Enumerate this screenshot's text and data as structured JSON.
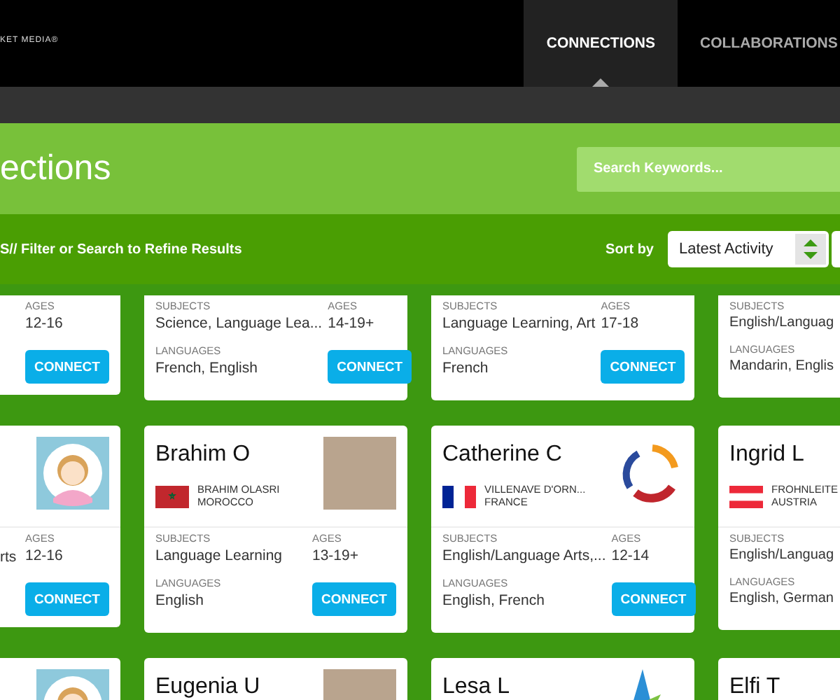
{
  "header": {
    "logo_text": "KET MEDIA®",
    "nav": [
      {
        "label": "CONNECTIONS",
        "selected": true
      },
      {
        "label": "COLLABORATIONS",
        "selected": false
      }
    ]
  },
  "title_band": {
    "title": "ections",
    "search": {
      "placeholder": "Search Keywords..."
    }
  },
  "filter_bar": {
    "hint": "S// Filter or Search to Refine Results",
    "sort_label": "Sort by",
    "sort_value": "Latest Activity"
  },
  "cards": [
    {
      "kind": "left",
      "ages": {
        "label": "AGES",
        "value": "12-16"
      },
      "connect": "CONNECT"
    },
    {
      "kind": "full",
      "subjects": {
        "label": "SUBJECTS",
        "value": "Science, Language Lea..."
      },
      "ages": {
        "label": "AGES",
        "value": "14-19+"
      },
      "languages": {
        "label": "LANGUAGES",
        "value": "French, English"
      },
      "connect": "CONNECT"
    },
    {
      "kind": "full",
      "subjects": {
        "label": "SUBJECTS",
        "value": "Language Learning, Art"
      },
      "ages": {
        "label": "AGES",
        "value": "17-18"
      },
      "languages": {
        "label": "LANGUAGES",
        "value": "French"
      },
      "connect": "CONNECT"
    },
    {
      "kind": "right",
      "subjects": {
        "label": "SUBJECTS",
        "value": "English/Languag"
      },
      "languages": {
        "label": "LANGUAGES",
        "value": "Mandarin, Englis"
      }
    },
    {
      "kind": "left",
      "avatar": {
        "kind": "cartoon"
      },
      "subjects": {
        "value": "rts"
      },
      "ages": {
        "label": "AGES",
        "value": "12-16"
      },
      "connect": "CONNECT"
    },
    {
      "kind": "full",
      "name": "Brahim O",
      "flag": {
        "kind": "morocco"
      },
      "place": "BRAHIM OLASRI",
      "country": "MOROCCO",
      "avatar": {
        "kind": "photo"
      },
      "subjects": {
        "label": "SUBJECTS",
        "value": "Language Learning"
      },
      "ages": {
        "label": "AGES",
        "value": "13-19+"
      },
      "languages": {
        "label": "LANGUAGES",
        "value": "English"
      },
      "connect": "CONNECT"
    },
    {
      "kind": "full",
      "name": "Catherine C",
      "flag": {
        "kind": "france"
      },
      "place": "VILLENAVE D'ORN...",
      "country": "FRANCE",
      "avatar": {
        "kind": "swirl"
      },
      "subjects": {
        "label": "SUBJECTS",
        "value": "English/Language Arts,..."
      },
      "ages": {
        "label": "AGES",
        "value": "12-14"
      },
      "languages": {
        "label": "LANGUAGES",
        "value": "English, French"
      },
      "connect": "CONNECT"
    },
    {
      "kind": "right",
      "name": "Ingrid L",
      "flag": {
        "kind": "austria"
      },
      "place": "FROHNLEITE",
      "country": "AUSTRIA",
      "subjects": {
        "label": "SUBJECTS",
        "value": "English/Languag"
      },
      "languages": {
        "label": "LANGUAGES",
        "value": "English, German"
      }
    },
    {
      "kind": "left",
      "avatar": {
        "kind": "cartoon"
      }
    },
    {
      "kind": "full",
      "name": "Eugenia U",
      "avatar": {
        "kind": "photo"
      }
    },
    {
      "kind": "full",
      "name": "Lesa L",
      "avatar": {
        "kind": "star"
      }
    },
    {
      "kind": "right",
      "name": "Elfi T"
    }
  ]
}
